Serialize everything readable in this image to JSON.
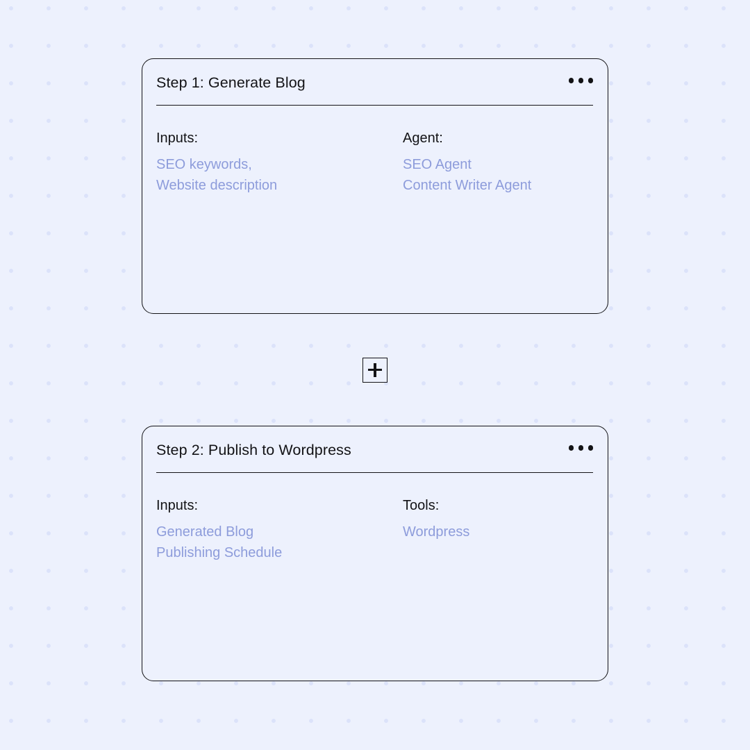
{
  "canvas": {
    "background_color": "#edf1fd",
    "dot_color": "#dbe2fa",
    "dot_spacing_px": 54
  },
  "theme": {
    "border_color": "#131316",
    "label_color": "#131316",
    "value_color": "#8d9cdb"
  },
  "steps": [
    {
      "title": "Step 1: Generate Blog",
      "menu_icon": "ellipsis-horizontal-icon",
      "left_field": {
        "label": "Inputs:",
        "values": [
          "SEO keywords,",
          "Website description"
        ]
      },
      "right_field": {
        "label": "Agent:",
        "values": [
          "SEO Agent",
          "Content Writer Agent"
        ]
      }
    },
    {
      "title": "Step 2: Publish to Wordpress",
      "menu_icon": "ellipsis-horizontal-icon",
      "left_field": {
        "label": "Inputs:",
        "values": [
          "Generated Blog",
          "Publishing Schedule"
        ]
      },
      "right_field": {
        "label": "Tools:",
        "values": [
          "Wordpress"
        ]
      }
    }
  ],
  "connector": {
    "add_button_icon": "plus-icon"
  }
}
